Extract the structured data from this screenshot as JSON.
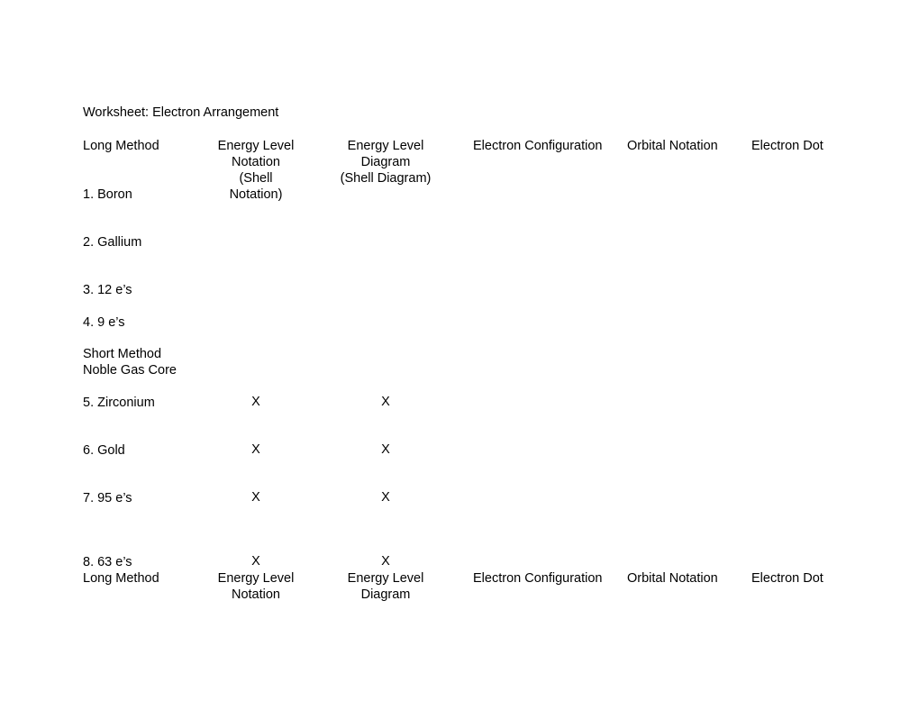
{
  "document": {
    "title": "Worksheet: Electron Arrangement"
  },
  "headers": {
    "top": {
      "col_a": "Long Method",
      "col_b_line1": "Energy Level",
      "col_b_line2": "Notation",
      "col_b_line3": "(Shell Notation)",
      "col_c_line1": "Energy Level",
      "col_c_line2": "Diagram",
      "col_c_line3": "(Shell Diagram)",
      "col_d": "Electron Configuration",
      "col_e": "Orbital Notation",
      "col_f": "Electron Dot"
    },
    "bottom": {
      "col_a": "Long Method",
      "col_b_line1": "Energy Level",
      "col_b_line2": "Notation",
      "col_c_line1": "Energy Level",
      "col_c_line2": "Diagram",
      "col_d": "Electron Configuration",
      "col_e": "Orbital Notation",
      "col_f": "Electron Dot"
    }
  },
  "section_label": {
    "line1": "Short Method",
    "line2": "Noble Gas Core"
  },
  "rows": [
    {
      "label": "1. Boron",
      "energy_level_notation": "",
      "energy_level_diagram": ""
    },
    {
      "label": "2. Gallium",
      "energy_level_notation": "",
      "energy_level_diagram": ""
    },
    {
      "label": "3. 12 e’s",
      "energy_level_notation": "",
      "energy_level_diagram": ""
    },
    {
      "label": "4. 9 e’s",
      "energy_level_notation": "",
      "energy_level_diagram": ""
    },
    {
      "label": "5. Zirconium",
      "energy_level_notation": "X",
      "energy_level_diagram": "X"
    },
    {
      "label": "6. Gold",
      "energy_level_notation": "X",
      "energy_level_diagram": "X"
    },
    {
      "label": "7. 95 e’s",
      "energy_level_notation": "X",
      "energy_level_diagram": "X"
    },
    {
      "label": "8. 63 e’s",
      "energy_level_notation": "X",
      "energy_level_diagram": "X"
    }
  ]
}
